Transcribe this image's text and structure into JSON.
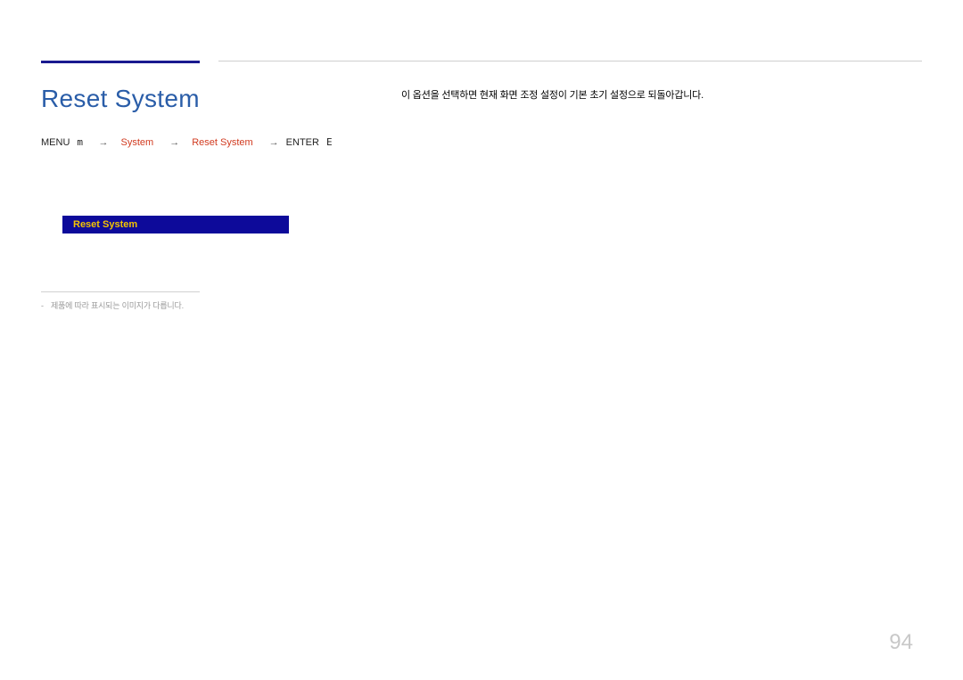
{
  "header": {
    "page_title": "Reset System"
  },
  "breadcrumb": {
    "menu_label": "MENU",
    "menu_icon": "m",
    "system": "System",
    "reset_system": "Reset System",
    "enter_label": "ENTER",
    "enter_icon": "E"
  },
  "menu_preview": {
    "selected_label": "Reset System"
  },
  "footnote": {
    "dash": "-",
    "text": "제품에 따라 표시되는 이미지가 다릅니다."
  },
  "description": {
    "text": "이 옵션을 선택하면 현재 화면 조정 설정이 기본 초기 설정으로 되돌아갑니다."
  },
  "page_number": "94"
}
